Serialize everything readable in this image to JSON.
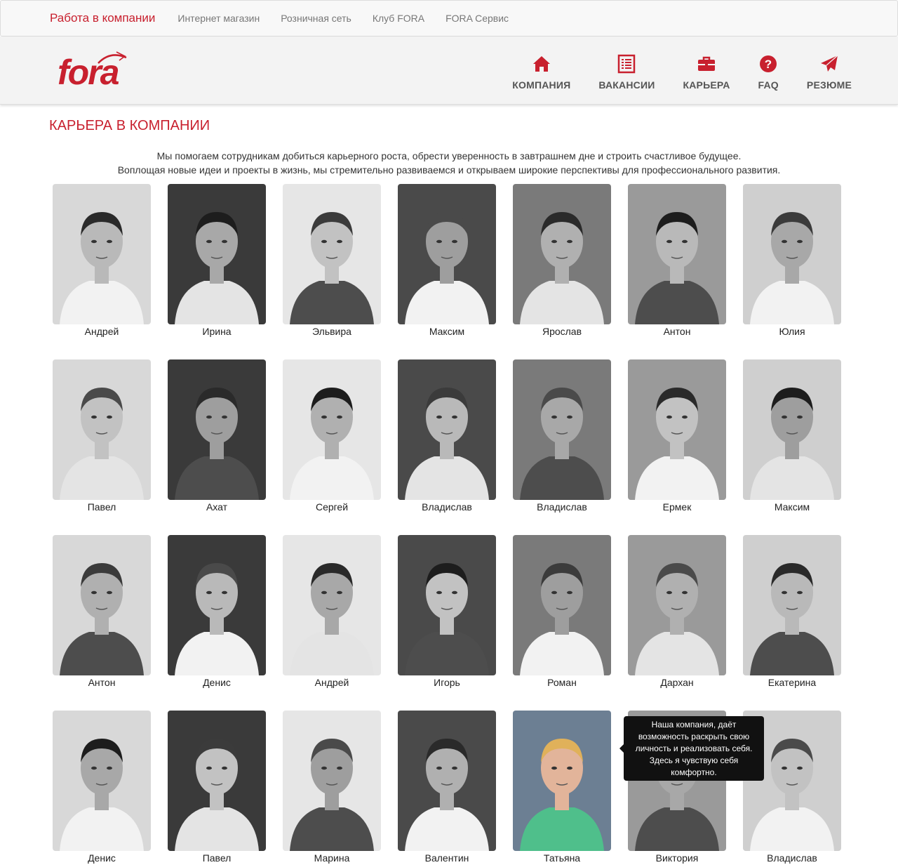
{
  "topnav": {
    "items": [
      {
        "label": "Работа в компании",
        "active": true
      },
      {
        "label": "Интернет магазин",
        "active": false
      },
      {
        "label": "Розничная сеть",
        "active": false
      },
      {
        "label": "Клуб FORA",
        "active": false
      },
      {
        "label": "FORA Сервис",
        "active": false
      }
    ]
  },
  "header": {
    "logo_text": "fora",
    "menu": [
      {
        "label": "КОМПАНИЯ",
        "icon": "home-icon"
      },
      {
        "label": "ВАКАНСИИ",
        "icon": "list-icon"
      },
      {
        "label": "КАРЬЕРА",
        "icon": "briefcase-icon"
      },
      {
        "label": "FAQ",
        "icon": "question-icon"
      },
      {
        "label": "РЕЗЮМЕ",
        "icon": "paper-plane-icon"
      }
    ]
  },
  "colors": {
    "accent": "#c8202e",
    "menu_text": "#555555",
    "tooltip_bg": "#111111"
  },
  "page": {
    "title": "КАРЬЕРА В КОМПАНИИ",
    "intro_line1": "Мы помогаем сотрудникам добиться карьерного роста, обрести уверенность в завтрашнем дне и строить счастливое будущее.",
    "intro_line2": "Воплощая новые идеи и проекты в жизнь, мы стремительно развиваемся и открываем широкие перспективы для профессионального развития."
  },
  "employees": [
    {
      "name": "Андрей"
    },
    {
      "name": "Ирина"
    },
    {
      "name": "Эльвира"
    },
    {
      "name": "Максим"
    },
    {
      "name": "Ярослав"
    },
    {
      "name": "Антон"
    },
    {
      "name": "Юлия"
    },
    {
      "name": "Павел"
    },
    {
      "name": "Ахат"
    },
    {
      "name": "Сергей"
    },
    {
      "name": "Владислав"
    },
    {
      "name": "Владислав"
    },
    {
      "name": "Ермек"
    },
    {
      "name": "Максим"
    },
    {
      "name": "Антон"
    },
    {
      "name": "Денис"
    },
    {
      "name": "Андрей"
    },
    {
      "name": "Игорь"
    },
    {
      "name": "Роман"
    },
    {
      "name": "Дархан"
    },
    {
      "name": "Екатерина"
    },
    {
      "name": "Денис"
    },
    {
      "name": "Павел"
    },
    {
      "name": "Марина"
    },
    {
      "name": "Валентин"
    },
    {
      "name": "Татьяна",
      "color_photo": true
    },
    {
      "name": "Виктория"
    },
    {
      "name": "Владислав"
    }
  ],
  "tooltip": {
    "text": "Наша компания, даёт возможность раскрыть свою личность и реализовать себя. Здесь я чувствую себя комфортно."
  }
}
